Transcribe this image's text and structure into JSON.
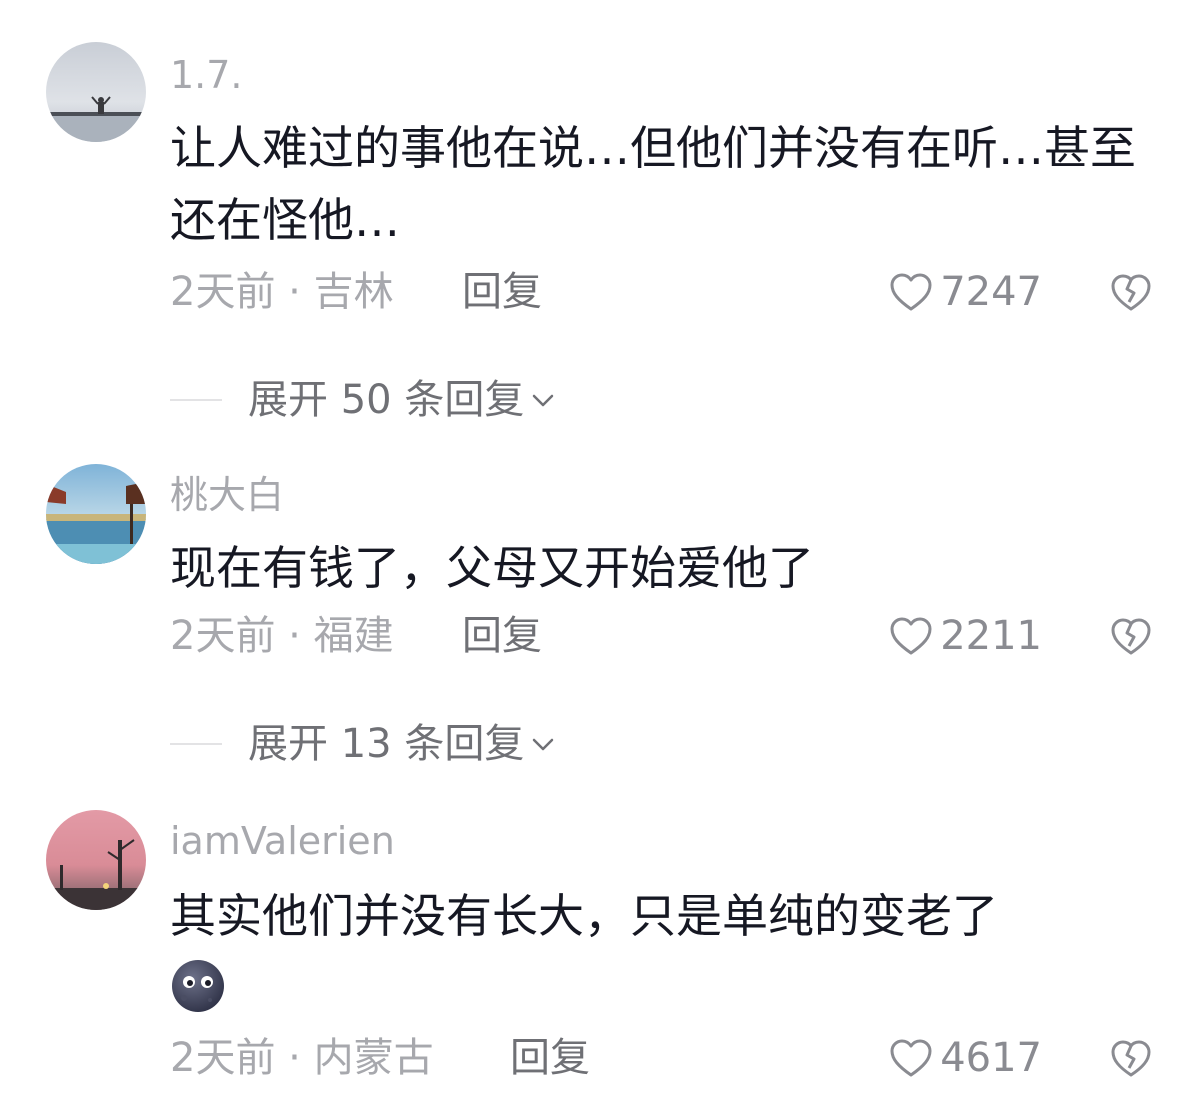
{
  "comments": [
    {
      "username": "1.7.",
      "text": "让人难过的事他在说…但他们并没有在听…甚至还在怪他…",
      "time_location": "2天前 · 吉林",
      "reply_label": "回复",
      "likes": "7247",
      "expand_label": "展开 50 条回复",
      "avatar_icon": "seaside-photo"
    },
    {
      "username": "桃大白",
      "text": "现在有钱了，父母又开始爱他了",
      "time_location": "2天前 · 福建",
      "reply_label": "回复",
      "likes": "2211",
      "expand_label": "展开 13 条回复",
      "avatar_icon": "coastal-view-photo"
    },
    {
      "username": "iamValerien",
      "text": "其实他们并没有长大，只是单纯的变老了",
      "emoji": "moon-face-emoji",
      "time_location": "2天前 · 内蒙古",
      "reply_label": "回复",
      "likes": "4617",
      "avatar_icon": "pink-sky-photo"
    }
  ],
  "colors": {
    "primary_text": "#161823",
    "secondary_text": "#a7a8ad",
    "reply_text": "#6f7075"
  }
}
